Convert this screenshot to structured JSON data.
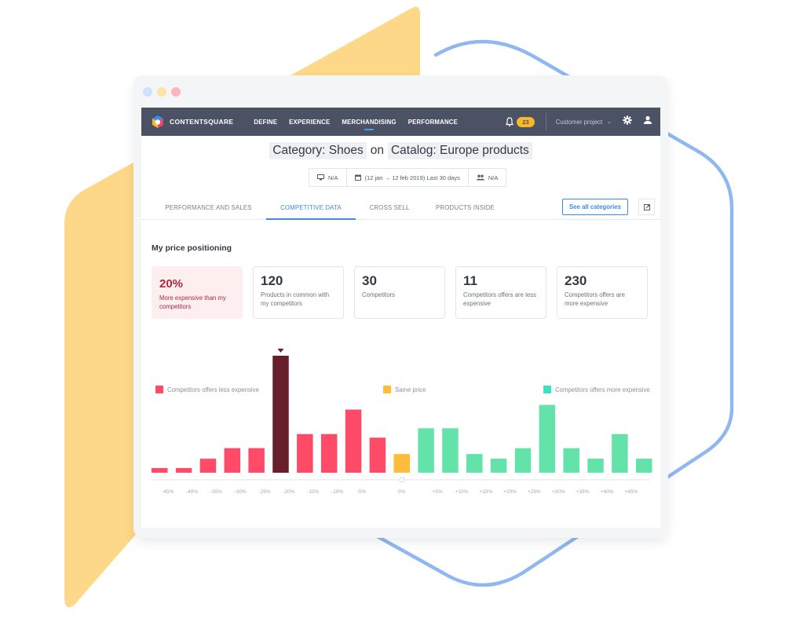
{
  "window": {
    "dots": [
      {
        "name": "blue",
        "color": "#cfe0fb"
      },
      {
        "name": "yellow",
        "color": "#fde4a8"
      },
      {
        "name": "red",
        "color": "#fcb6c0"
      }
    ]
  },
  "navbar": {
    "brand": "CONTENTSQUARE",
    "items": [
      {
        "label": "DEFINE",
        "active": false
      },
      {
        "label": "EXPERIENCE",
        "active": false
      },
      {
        "label": "MERCHANDISING",
        "active": true
      },
      {
        "label": "PERFORMANCE",
        "active": false
      }
    ],
    "notification_count": "23",
    "project_selector": "Customer project",
    "icons": [
      "bell-icon",
      "chevron-down-icon",
      "gear-icon",
      "user-icon"
    ]
  },
  "header": {
    "category": "Category: Shoes",
    "connector": "on",
    "catalog": "Catalog: Europe products"
  },
  "filters": {
    "device": "N/A",
    "date_range": "(12 jan → 12 feb 2019) Last 30 days",
    "segment": "N/A"
  },
  "tabs": [
    {
      "label": "PERFORMANCE AND SALES",
      "active": false
    },
    {
      "label": "COMPETITIVE DATA",
      "active": true
    },
    {
      "label": "CROSS SELL",
      "active": false
    },
    {
      "label": "PRODUCTS INSIDE",
      "active": false
    }
  ],
  "actions": {
    "see_all": "See  all categories",
    "external_link_icon": "external-link-icon"
  },
  "section": {
    "title": "My price positioning"
  },
  "cards": [
    {
      "value": "20%",
      "label": "More expensive than my competitors",
      "highlight": true
    },
    {
      "value": "120",
      "label": "Products in common with my competitors",
      "highlight": false
    },
    {
      "value": "30",
      "label": "Competitors",
      "highlight": false
    },
    {
      "value": "11",
      "label": "Competitors offers are less expensive",
      "highlight": false
    },
    {
      "value": "230",
      "label": "Competitors offers are more expensive",
      "highlight": false
    }
  ],
  "colors": {
    "less_expensive": "#ff4b68",
    "selected": "#661f2b",
    "same_price": "#ffbb3c",
    "more_expensive": "#63e3a9",
    "accent": "#3e8be6",
    "navbar": "#4b5264"
  },
  "chart_data": {
    "type": "bar",
    "title": "My price positioning",
    "value_unit": "relative bar height (% of tallest bar), no y-axis shown",
    "tick_labels": [
      "-45%",
      "-40%",
      "-35%",
      "-30%",
      "-25%",
      "-20%",
      "-15%",
      "-10%",
      "-5%",
      "0%",
      "+5%",
      "+10%",
      "+15%",
      "+20%",
      "+25%",
      "+30%",
      "+35%",
      "+40%",
      "+45%"
    ],
    "bars": [
      {
        "group": "less",
        "value": 4
      },
      {
        "group": "less",
        "value": 4
      },
      {
        "group": "less",
        "value": 12
      },
      {
        "group": "less",
        "value": 21
      },
      {
        "group": "less",
        "value": 21
      },
      {
        "group": "selected",
        "value": 100,
        "marker": true
      },
      {
        "group": "less",
        "value": 33
      },
      {
        "group": "less",
        "value": 33
      },
      {
        "group": "less",
        "value": 54
      },
      {
        "group": "less",
        "value": 30
      },
      {
        "group": "same",
        "value": 16
      },
      {
        "group": "more",
        "value": 38
      },
      {
        "group": "more",
        "value": 38
      },
      {
        "group": "more",
        "value": 16
      },
      {
        "group": "more",
        "value": 12
      },
      {
        "group": "more",
        "value": 21
      },
      {
        "group": "more",
        "value": 58
      },
      {
        "group": "more",
        "value": 21
      },
      {
        "group": "more",
        "value": 12
      },
      {
        "group": "more",
        "value": 33
      },
      {
        "group": "more",
        "value": 12
      }
    ],
    "legend": [
      {
        "label": "Competitors offers less expensive",
        "color": "#ff4b68"
      },
      {
        "label": "Same price",
        "color": "#ffbb3c"
      },
      {
        "label": "Competitors offers more expensive",
        "color": "#40dfc0"
      }
    ],
    "legend_position": "bottom",
    "grid": false
  }
}
